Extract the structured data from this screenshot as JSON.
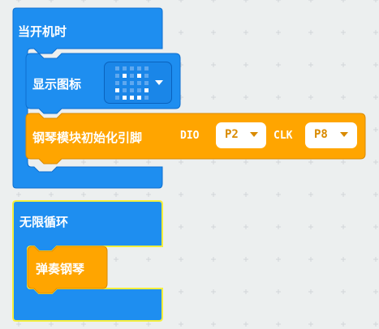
{
  "blocks": {
    "on_start": {
      "label": "当开机时"
    },
    "show_icon": {
      "label": "显示图标",
      "icon": "smiley-face-icon"
    },
    "piano_init": {
      "label": "钢琴模块初始化引脚",
      "dio_label": "DIO",
      "dio_value": "P2",
      "clk_label": "CLK",
      "clk_value": "P8"
    },
    "forever": {
      "label": "无限循环"
    },
    "play_piano": {
      "label": "弹奏钢琴"
    }
  },
  "colors": {
    "basic_blue": "#1e8ef0",
    "basic_blue_edge": "#0d6fd0",
    "piano_orange": "#ffa500",
    "piano_orange_edge": "#d98a00",
    "selected_outline": "#f5ef3c",
    "workspace": "#ecefef"
  }
}
